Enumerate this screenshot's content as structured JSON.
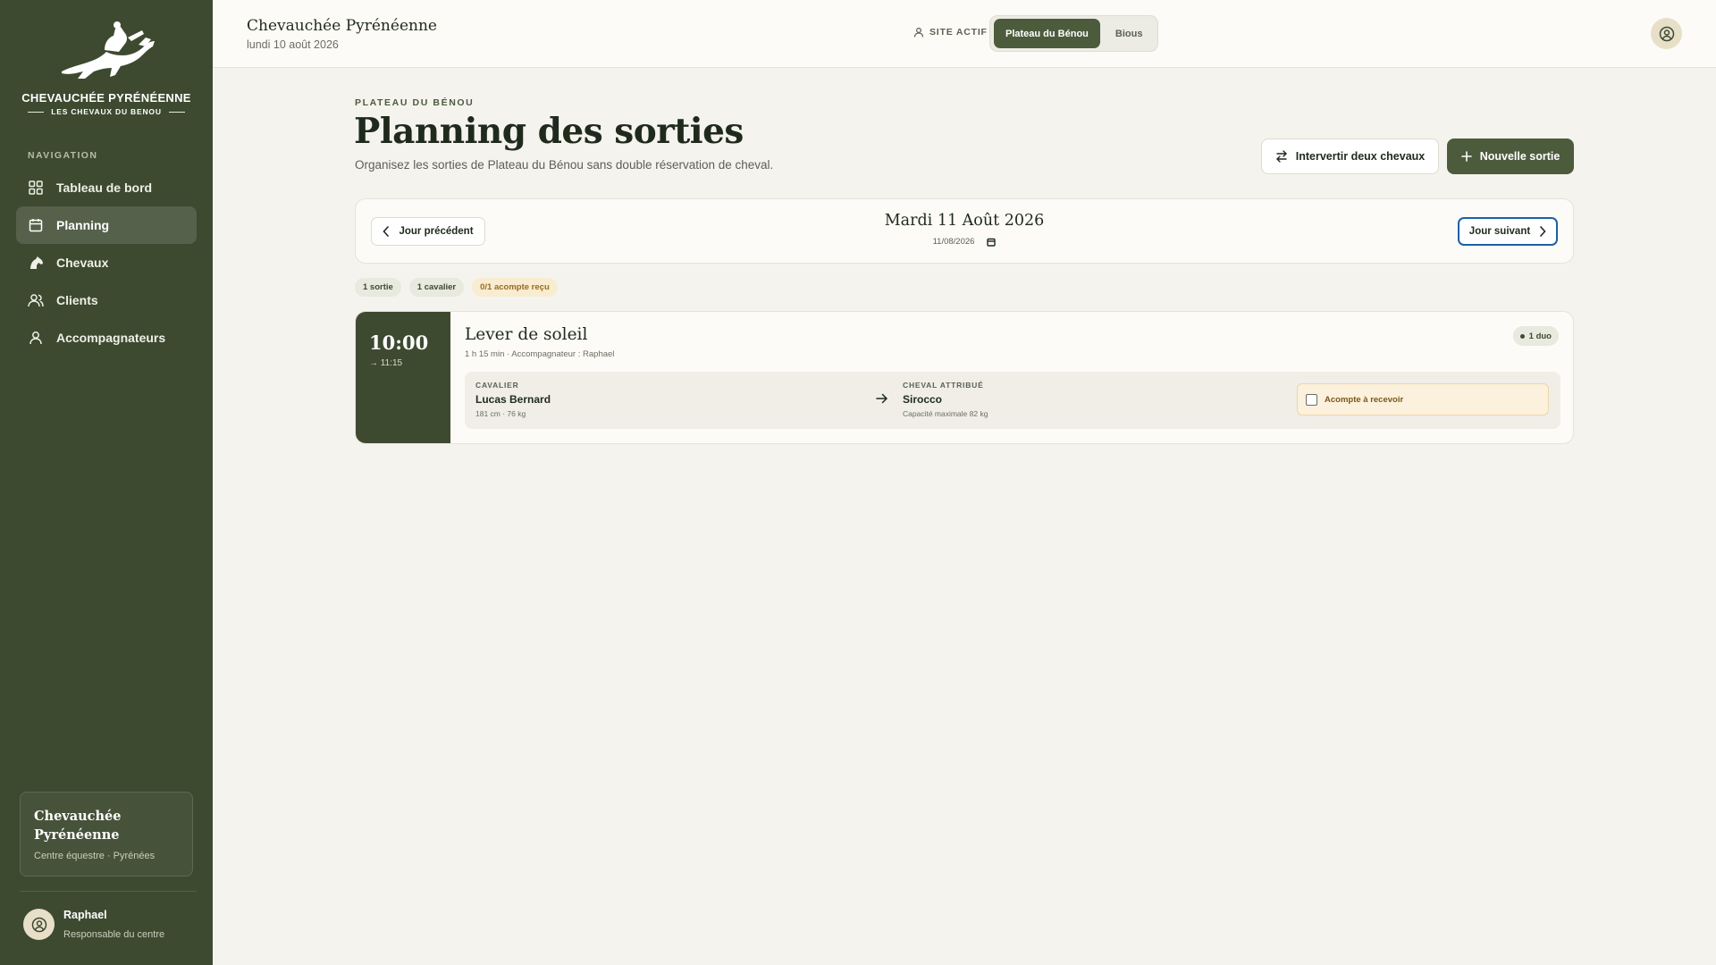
{
  "brand": {
    "name": "CHEVAUCHÉE PYRÉNÉENNE",
    "tagline": "LES CHEVAUX DU BENOU"
  },
  "sidebar": {
    "heading": "NAVIGATION",
    "items": [
      {
        "label": "Tableau de bord",
        "icon": "dashboard-icon",
        "active": false
      },
      {
        "label": "Planning",
        "icon": "calendar-icon",
        "active": true
      },
      {
        "label": "Chevaux",
        "icon": "horse-icon",
        "active": false
      },
      {
        "label": "Clients",
        "icon": "users-icon",
        "active": false
      },
      {
        "label": "Accompagnateurs",
        "icon": "user-icon",
        "active": false
      }
    ],
    "centre": {
      "name": "Chevauchée Pyrénéenne",
      "subtitle": "Centre équestre · Pyrénées"
    },
    "user": {
      "name": "Raphael",
      "role": "Responsable du centre"
    }
  },
  "topbar": {
    "title": "Chevauchée Pyrénéenne",
    "date": "lundi 10 août 2026",
    "site_label": "SITE ACTIF",
    "sites": [
      "Plateau du Bénou",
      "Bious"
    ],
    "active_site": "Plateau du Bénou"
  },
  "page": {
    "eyebrow": "PLATEAU DU BÉNOU",
    "title": "Planning des sorties",
    "description": "Organisez les sorties de Plateau du Bénou sans double réservation de cheval.",
    "swap_button": "Intervertir deux chevaux",
    "new_button": "Nouvelle sortie"
  },
  "day_nav": {
    "prev": "Jour précédent",
    "next": "Jour suivant",
    "day_title": "Mardi 11 Août 2026",
    "date_input": "11/08/2026"
  },
  "chips": [
    "1 sortie",
    "1 cavalier",
    "0/1 acompte reçu"
  ],
  "outing": {
    "start": "10:00",
    "end": "→ 11:15",
    "title": "Lever de soleil",
    "meta": "1 h 15 min · Accompagnateur : Raphael",
    "badge": "1 duo",
    "rider_label": "CAVALIER",
    "rider_name": "Lucas Bernard",
    "rider_info": "181 cm · 76 kg",
    "horse_label": "CHEVAL ATTRIBUÉ",
    "horse_name": "Sirocco",
    "horse_info": "Capacité maximale 82 kg",
    "deposit": "Acompte à recevoir",
    "deposit_checked": false
  },
  "colors": {
    "sidebar": "#3d4a30",
    "accent": "#4d5b3d",
    "warning": "#fbf1dc",
    "focus": "#1f5fa8"
  }
}
